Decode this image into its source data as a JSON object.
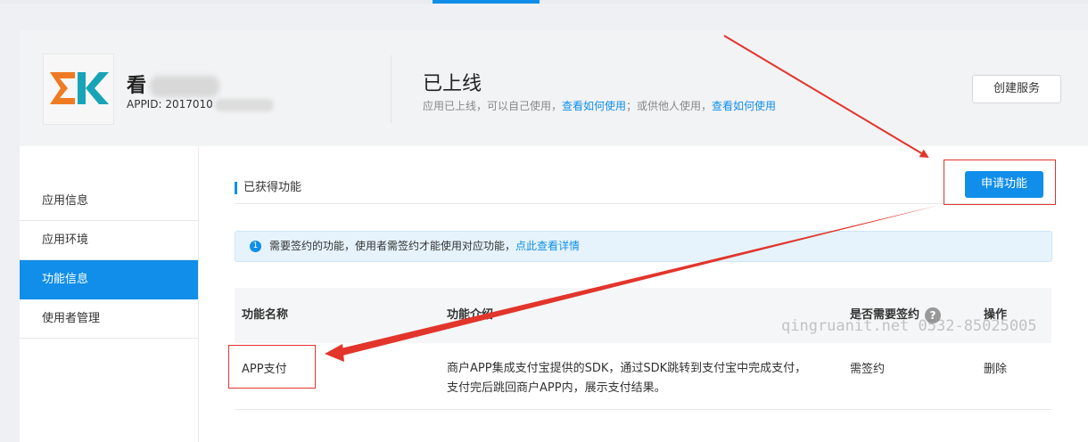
{
  "app": {
    "name": "看",
    "appid": "APPID: 2017010",
    "status_title": "已上线",
    "status_desc_1": "应用已上线，可以自己使用，",
    "status_link_1": "查看如何使用",
    "status_desc_2": "；或供他人使用，",
    "status_link_2": "查看如何使用",
    "create_service": "创建服务"
  },
  "sidebar": {
    "items": [
      {
        "label": "应用信息",
        "active": false
      },
      {
        "label": "应用环境",
        "active": false
      },
      {
        "label": "功能信息",
        "active": true
      },
      {
        "label": "使用者管理",
        "active": false
      }
    ]
  },
  "section": {
    "title": "已获得功能",
    "apply_button": "申请功能"
  },
  "notice": {
    "icon": "1",
    "text": "需要签约的功能，使用者需签约才能使用对应功能，",
    "link": "点此查看详情"
  },
  "table": {
    "headers": [
      "功能名称",
      "功能介绍",
      "是否需要签约",
      "操作"
    ],
    "help_icon": "?",
    "rows": [
      {
        "name": "APP支付",
        "desc_line1": "商户APP集成支付宝提供的SDK，通过SDK跳转到支付宝中完成支付，",
        "desc_line2": "支付完后跳回商户APP内，展示支付结果。",
        "sign": "需签约",
        "action": "删除"
      }
    ]
  },
  "watermark": "qingruanit.net 0532-85025005",
  "colors": {
    "accent": "#108ee9",
    "annotation": "#e2352c",
    "logo_orange": "#f07a22",
    "logo_teal": "#17a4b8"
  }
}
